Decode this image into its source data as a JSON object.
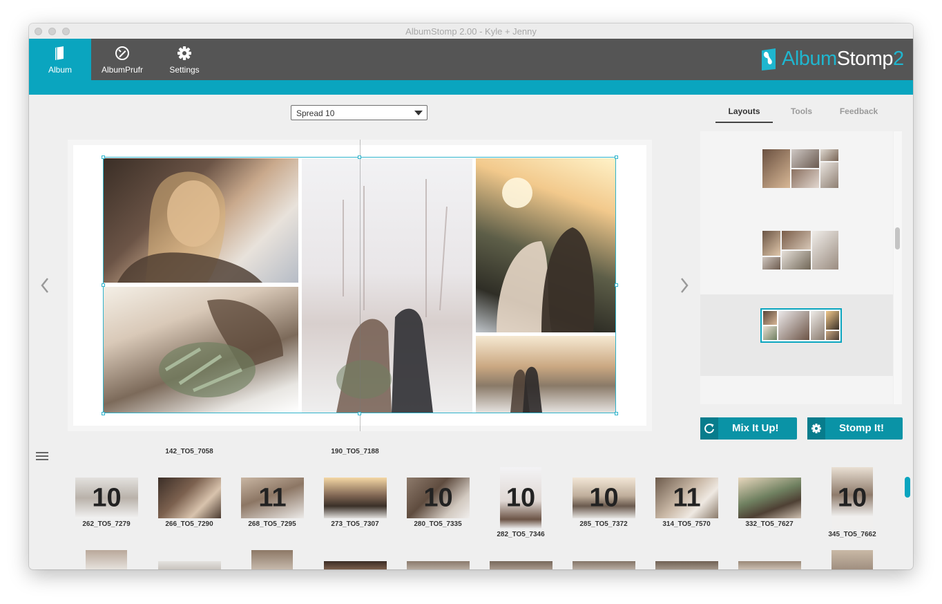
{
  "window": {
    "title": "AlbumStomp 2.00 - Kyle + Jenny"
  },
  "toolbar": {
    "items": [
      {
        "label": "Album",
        "icon": "album-icon",
        "active": true
      },
      {
        "label": "AlbumPrufr",
        "icon": "albumprufr-icon",
        "active": false
      },
      {
        "label": "Settings",
        "icon": "gear-icon",
        "active": false
      }
    ],
    "logo": {
      "part1": "Album",
      "part2": "Stomp",
      "part3": "2"
    }
  },
  "spread_select": {
    "value": "Spread 10"
  },
  "right_tabs": [
    {
      "label": "Layouts",
      "active": true
    },
    {
      "label": "Tools",
      "active": false
    },
    {
      "label": "Feedback",
      "active": false
    }
  ],
  "actions": {
    "mix_label": "Mix It Up!",
    "stomp_label": "Stomp It!"
  },
  "colors": {
    "accent": "#0aa5bf",
    "button": "#0a93a6",
    "toolbar": "#555555"
  },
  "filmstrip": {
    "top_captions": [
      "142_TO5_7058",
      "190_TO5_7188"
    ],
    "row1": [
      {
        "count": "10",
        "name": "262_TO5_7279"
      },
      {
        "count": "",
        "name": "266_TO5_7290"
      },
      {
        "count": "11",
        "name": "268_TO5_7295"
      },
      {
        "count": "",
        "name": "273_TO5_7307"
      },
      {
        "count": "10",
        "name": "280_TO5_7335"
      },
      {
        "count": "10",
        "name": "282_TO5_7346"
      },
      {
        "count": "10",
        "name": "285_TO5_7372"
      },
      {
        "count": "11",
        "name": "314_TO5_7570"
      },
      {
        "count": "",
        "name": "332_TO5_7627"
      },
      {
        "count": "10",
        "name": "345_TO5_7662"
      }
    ]
  }
}
